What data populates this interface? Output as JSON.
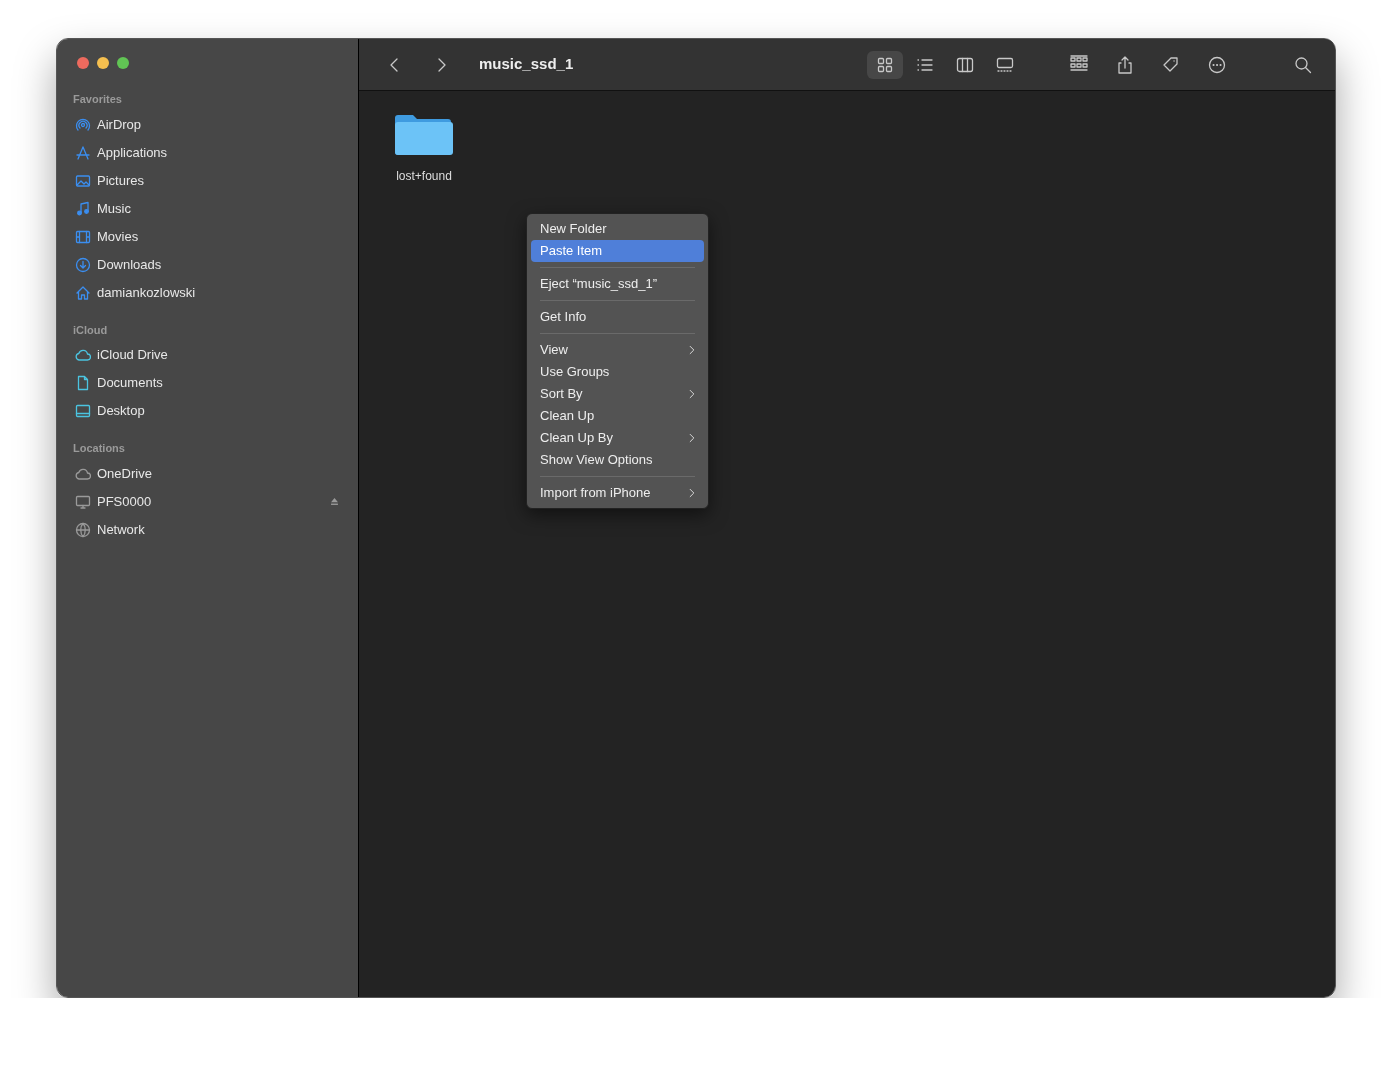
{
  "window": {
    "title": "music_ssd_1"
  },
  "view_modes": [
    {
      "kind": "icons",
      "selected": true
    },
    {
      "kind": "list",
      "selected": false
    },
    {
      "kind": "columns",
      "selected": false
    },
    {
      "kind": "gallery",
      "selected": false
    }
  ],
  "sidebar": {
    "sections": [
      {
        "title": "Favorites",
        "items": [
          {
            "label": "AirDrop",
            "kind": "airdrop"
          },
          {
            "label": "Applications",
            "kind": "apps"
          },
          {
            "label": "Pictures",
            "kind": "pictures"
          },
          {
            "label": "Music",
            "kind": "music"
          },
          {
            "label": "Movies",
            "kind": "movies"
          },
          {
            "label": "Downloads",
            "kind": "downloads"
          },
          {
            "label": "damiankozlowski",
            "kind": "home"
          }
        ]
      },
      {
        "title": "iCloud",
        "items": [
          {
            "label": "iCloud Drive",
            "kind": "cloud"
          },
          {
            "label": "Documents",
            "kind": "document"
          },
          {
            "label": "Desktop",
            "kind": "desktop"
          }
        ]
      },
      {
        "title": "Locations",
        "items": [
          {
            "label": "OneDrive",
            "kind": "cloudgray",
            "ejectable": false
          },
          {
            "label": "PFS0000",
            "kind": "monitor",
            "ejectable": true
          },
          {
            "label": "Network",
            "kind": "globe",
            "ejectable": false
          }
        ]
      }
    ]
  },
  "files": [
    {
      "name": "lost+found"
    }
  ],
  "context_menu": {
    "groups": [
      [
        {
          "label": "New Folder",
          "selected": false,
          "submenu": false
        },
        {
          "label": "Paste Item",
          "selected": true,
          "submenu": false
        }
      ],
      [
        {
          "label": "Eject “music_ssd_1”",
          "selected": false,
          "submenu": false
        }
      ],
      [
        {
          "label": "Get Info",
          "selected": false,
          "submenu": false
        }
      ],
      [
        {
          "label": "View",
          "selected": false,
          "submenu": true
        },
        {
          "label": "Use Groups",
          "selected": false,
          "submenu": false
        },
        {
          "label": "Sort By",
          "selected": false,
          "submenu": true
        },
        {
          "label": "Clean Up",
          "selected": false,
          "submenu": false
        },
        {
          "label": "Clean Up By",
          "selected": false,
          "submenu": true
        },
        {
          "label": "Show View Options",
          "selected": false,
          "submenu": false
        }
      ],
      [
        {
          "label": "Import from iPhone",
          "selected": false,
          "submenu": true
        }
      ]
    ]
  }
}
